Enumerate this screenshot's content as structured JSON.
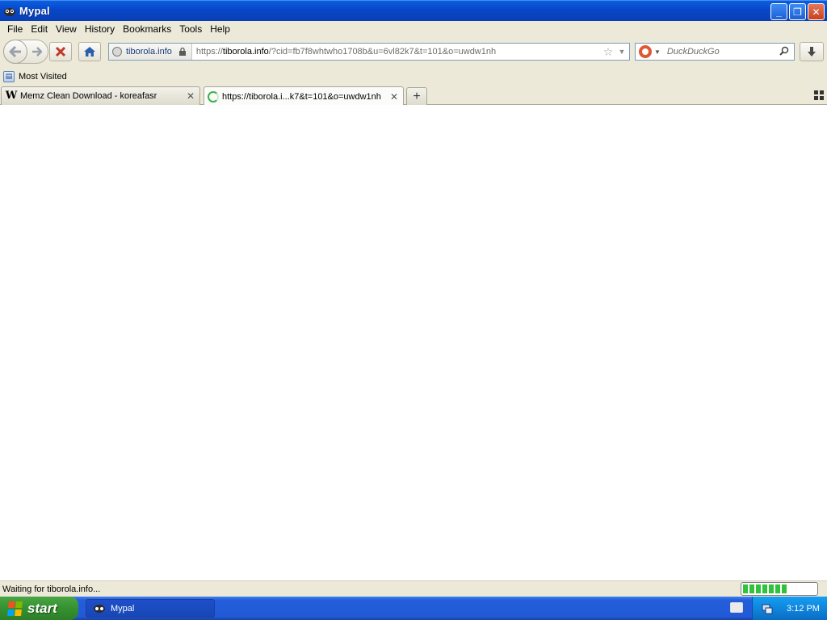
{
  "window": {
    "title": "Mypal",
    "minimize": "_",
    "restore": "❐",
    "close": "✕"
  },
  "menu": [
    {
      "label": "File"
    },
    {
      "label": "Edit"
    },
    {
      "label": "View"
    },
    {
      "label": "History"
    },
    {
      "label": "Bookmarks"
    },
    {
      "label": "Tools"
    },
    {
      "label": "Help"
    }
  ],
  "nav": {
    "identity_label": "tiborola.info",
    "url_prefix": "https://",
    "url_host": "tiborola.info",
    "url_rest": "/?cid=fb7f8whtwho1708b&u=6vl82k7&t=101&o=uwdw1nh",
    "search_placeholder": "DuckDuckGo"
  },
  "bookmarks": {
    "most_visited": "Most Visited"
  },
  "tabs": [
    {
      "label": "Memz Clean Download - koreafasr",
      "favicon": "W",
      "state": "inactive"
    },
    {
      "label": "https://tiborola.i...k7&t=101&o=uwdw1nh",
      "state": "loading"
    }
  ],
  "status": {
    "text": "Waiting for tiborola.info...",
    "progress": 0.6
  },
  "taskbar": {
    "start_label": "start",
    "task_label": "Mypal",
    "clock": "3:12 PM"
  },
  "colors": {
    "titlebar": "#0747c8",
    "start_green": "#35922f",
    "tray_blue": "#0f86dd",
    "progress_green": "#2fc23c"
  },
  "icons": {
    "back": "back-arrow-icon",
    "forward": "forward-arrow-icon",
    "stop": "stop-icon",
    "home": "home-icon",
    "bookmark_star": "star-icon",
    "search": "magnifier-icon",
    "download": "download-arrow-icon",
    "new_tab": "plus-icon",
    "tab_list": "grid-icon"
  }
}
